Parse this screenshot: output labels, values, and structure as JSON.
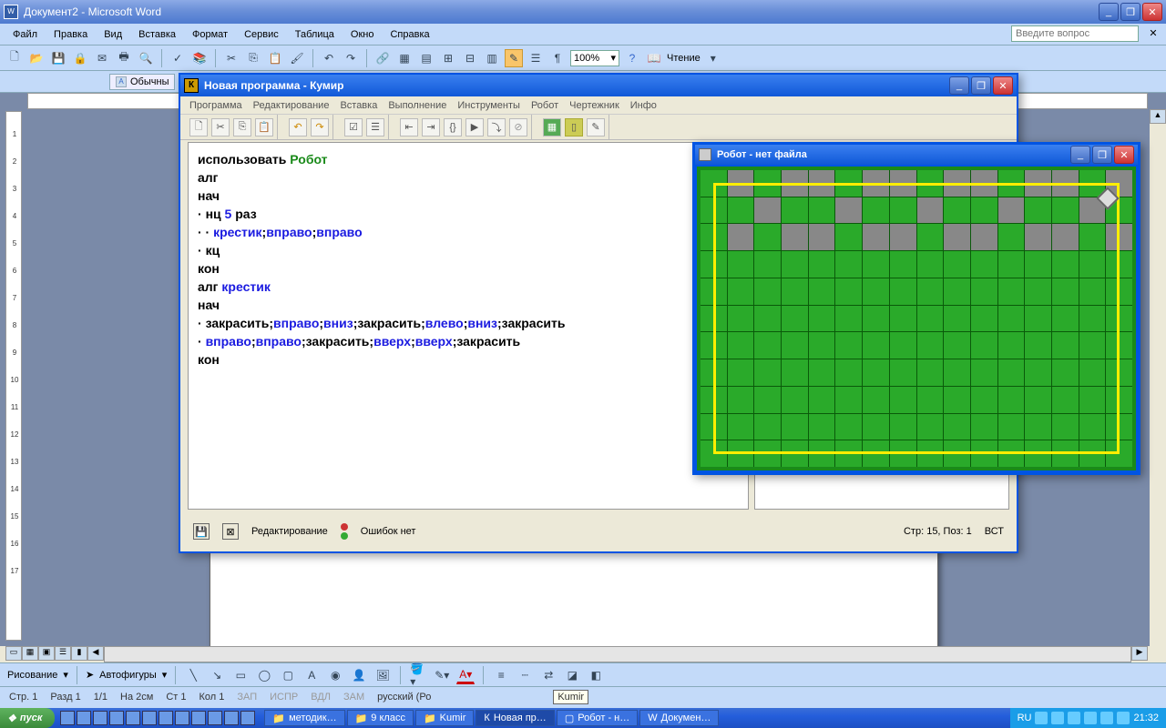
{
  "word": {
    "title": "Документ2 - Microsoft Word",
    "menu": [
      "Файл",
      "Правка",
      "Вид",
      "Вставка",
      "Формат",
      "Сервис",
      "Таблица",
      "Окно",
      "Справка"
    ],
    "help_placeholder": "Введите вопрос",
    "zoom": "100%",
    "reading": "Чтение",
    "tab": "Обычны",
    "draw_label": "Рисование",
    "autoshapes": "Автофигуры",
    "status": {
      "page": "Стр. 1",
      "section": "Разд 1",
      "pages": "1/1",
      "at": "На 2см",
      "line": "Ст 1",
      "col": "Кол 1",
      "flags": [
        "ЗАП",
        "ИСПР",
        "ВДЛ",
        "ЗАМ"
      ],
      "lang": "русский (Ро",
      "tip": "Kumir"
    }
  },
  "kumir": {
    "title": "Новая программа - Кумир",
    "menu": [
      "Программа",
      "Редактирование",
      "Вставка",
      "Выполнение",
      "Инструменты",
      "Робот",
      "Чертежник",
      "Инфо"
    ],
    "status_mode": "Редактирование",
    "status_errors": "Ошибок нет",
    "status_pos": "Стр: 15, Поз: 1",
    "status_ins": "ВСТ",
    "code": [
      [
        {
          "t": "использовать ",
          "c": "kw-black"
        },
        {
          "t": "Робот",
          "c": "kw-green"
        }
      ],
      [
        {
          "t": "алг",
          "c": "kw-black"
        }
      ],
      [
        {
          "t": "нач",
          "c": "kw-black"
        }
      ],
      [
        {
          "t": "· ",
          "c": "dot"
        },
        {
          "t": "нц ",
          "c": "kw-black"
        },
        {
          "t": "5",
          "c": "kw-blue"
        },
        {
          "t": " раз",
          "c": "kw-black"
        }
      ],
      [
        {
          "t": "· · ",
          "c": "dot"
        },
        {
          "t": "крестик",
          "c": "kw-blue"
        },
        {
          "t": ";",
          "c": "kw-black"
        },
        {
          "t": "вправо",
          "c": "kw-blue"
        },
        {
          "t": ";",
          "c": "kw-black"
        },
        {
          "t": "вправо",
          "c": "kw-blue"
        }
      ],
      [
        {
          "t": "· ",
          "c": "dot"
        },
        {
          "t": "кц",
          "c": "kw-black"
        }
      ],
      [
        {
          "t": "кон",
          "c": "kw-black"
        }
      ],
      [
        {
          "t": "алг ",
          "c": "kw-black"
        },
        {
          "t": "крестик",
          "c": "kw-blue"
        }
      ],
      [
        {
          "t": "нач",
          "c": "kw-black"
        }
      ],
      [
        {
          "t": "· ",
          "c": "dot"
        },
        {
          "t": "закрасить",
          "c": "kw-black"
        },
        {
          "t": ";",
          "c": "kw-black"
        },
        {
          "t": "вправо",
          "c": "kw-blue"
        },
        {
          "t": ";",
          "c": "kw-black"
        },
        {
          "t": "вниз",
          "c": "kw-blue"
        },
        {
          "t": ";",
          "c": "kw-black"
        },
        {
          "t": "закрасить",
          "c": "kw-black"
        },
        {
          "t": ";",
          "c": "kw-black"
        },
        {
          "t": "влево",
          "c": "kw-blue"
        },
        {
          "t": ";",
          "c": "kw-black"
        },
        {
          "t": "вниз",
          "c": "kw-blue"
        },
        {
          "t": ";",
          "c": "kw-black"
        },
        {
          "t": "закрасить",
          "c": "kw-black"
        }
      ],
      [
        {
          "t": "· ",
          "c": "dot"
        },
        {
          "t": "вправо",
          "c": "kw-blue"
        },
        {
          "t": ";",
          "c": "kw-black"
        },
        {
          "t": "вправо",
          "c": "kw-blue"
        },
        {
          "t": ";",
          "c": "kw-black"
        },
        {
          "t": "закрасить",
          "c": "kw-black"
        },
        {
          "t": ";",
          "c": "kw-black"
        },
        {
          "t": "вверх",
          "c": "kw-blue"
        },
        {
          "t": ";",
          "c": "kw-black"
        },
        {
          "t": "вверх",
          "c": "kw-blue"
        },
        {
          "t": ";",
          "c": "kw-black"
        },
        {
          "t": "закрасить",
          "c": "kw-black"
        }
      ],
      [
        {
          "t": "кон",
          "c": "kw-black"
        }
      ]
    ]
  },
  "robot": {
    "title": "Робот - нет файла",
    "gray_cells": [
      [
        0,
        1
      ],
      [
        0,
        3
      ],
      [
        0,
        4
      ],
      [
        0,
        6
      ],
      [
        0,
        7
      ],
      [
        0,
        9
      ],
      [
        0,
        10
      ],
      [
        0,
        12
      ],
      [
        0,
        13
      ],
      [
        0,
        15
      ],
      [
        1,
        2
      ],
      [
        1,
        5
      ],
      [
        1,
        8
      ],
      [
        1,
        11
      ],
      [
        1,
        14
      ],
      [
        2,
        1
      ],
      [
        2,
        3
      ],
      [
        2,
        4
      ],
      [
        2,
        6
      ],
      [
        2,
        7
      ],
      [
        2,
        9
      ],
      [
        2,
        10
      ],
      [
        2,
        12
      ],
      [
        2,
        13
      ],
      [
        2,
        15
      ]
    ],
    "cols": 16,
    "rows": 11
  },
  "taskbar": {
    "start": "пуск",
    "tasks": [
      "методик…",
      "9 класс",
      "Kumir",
      "Новая пр…",
      "Робот - н…",
      "Докумен…"
    ],
    "lang": "RU",
    "clock": "21:32"
  }
}
